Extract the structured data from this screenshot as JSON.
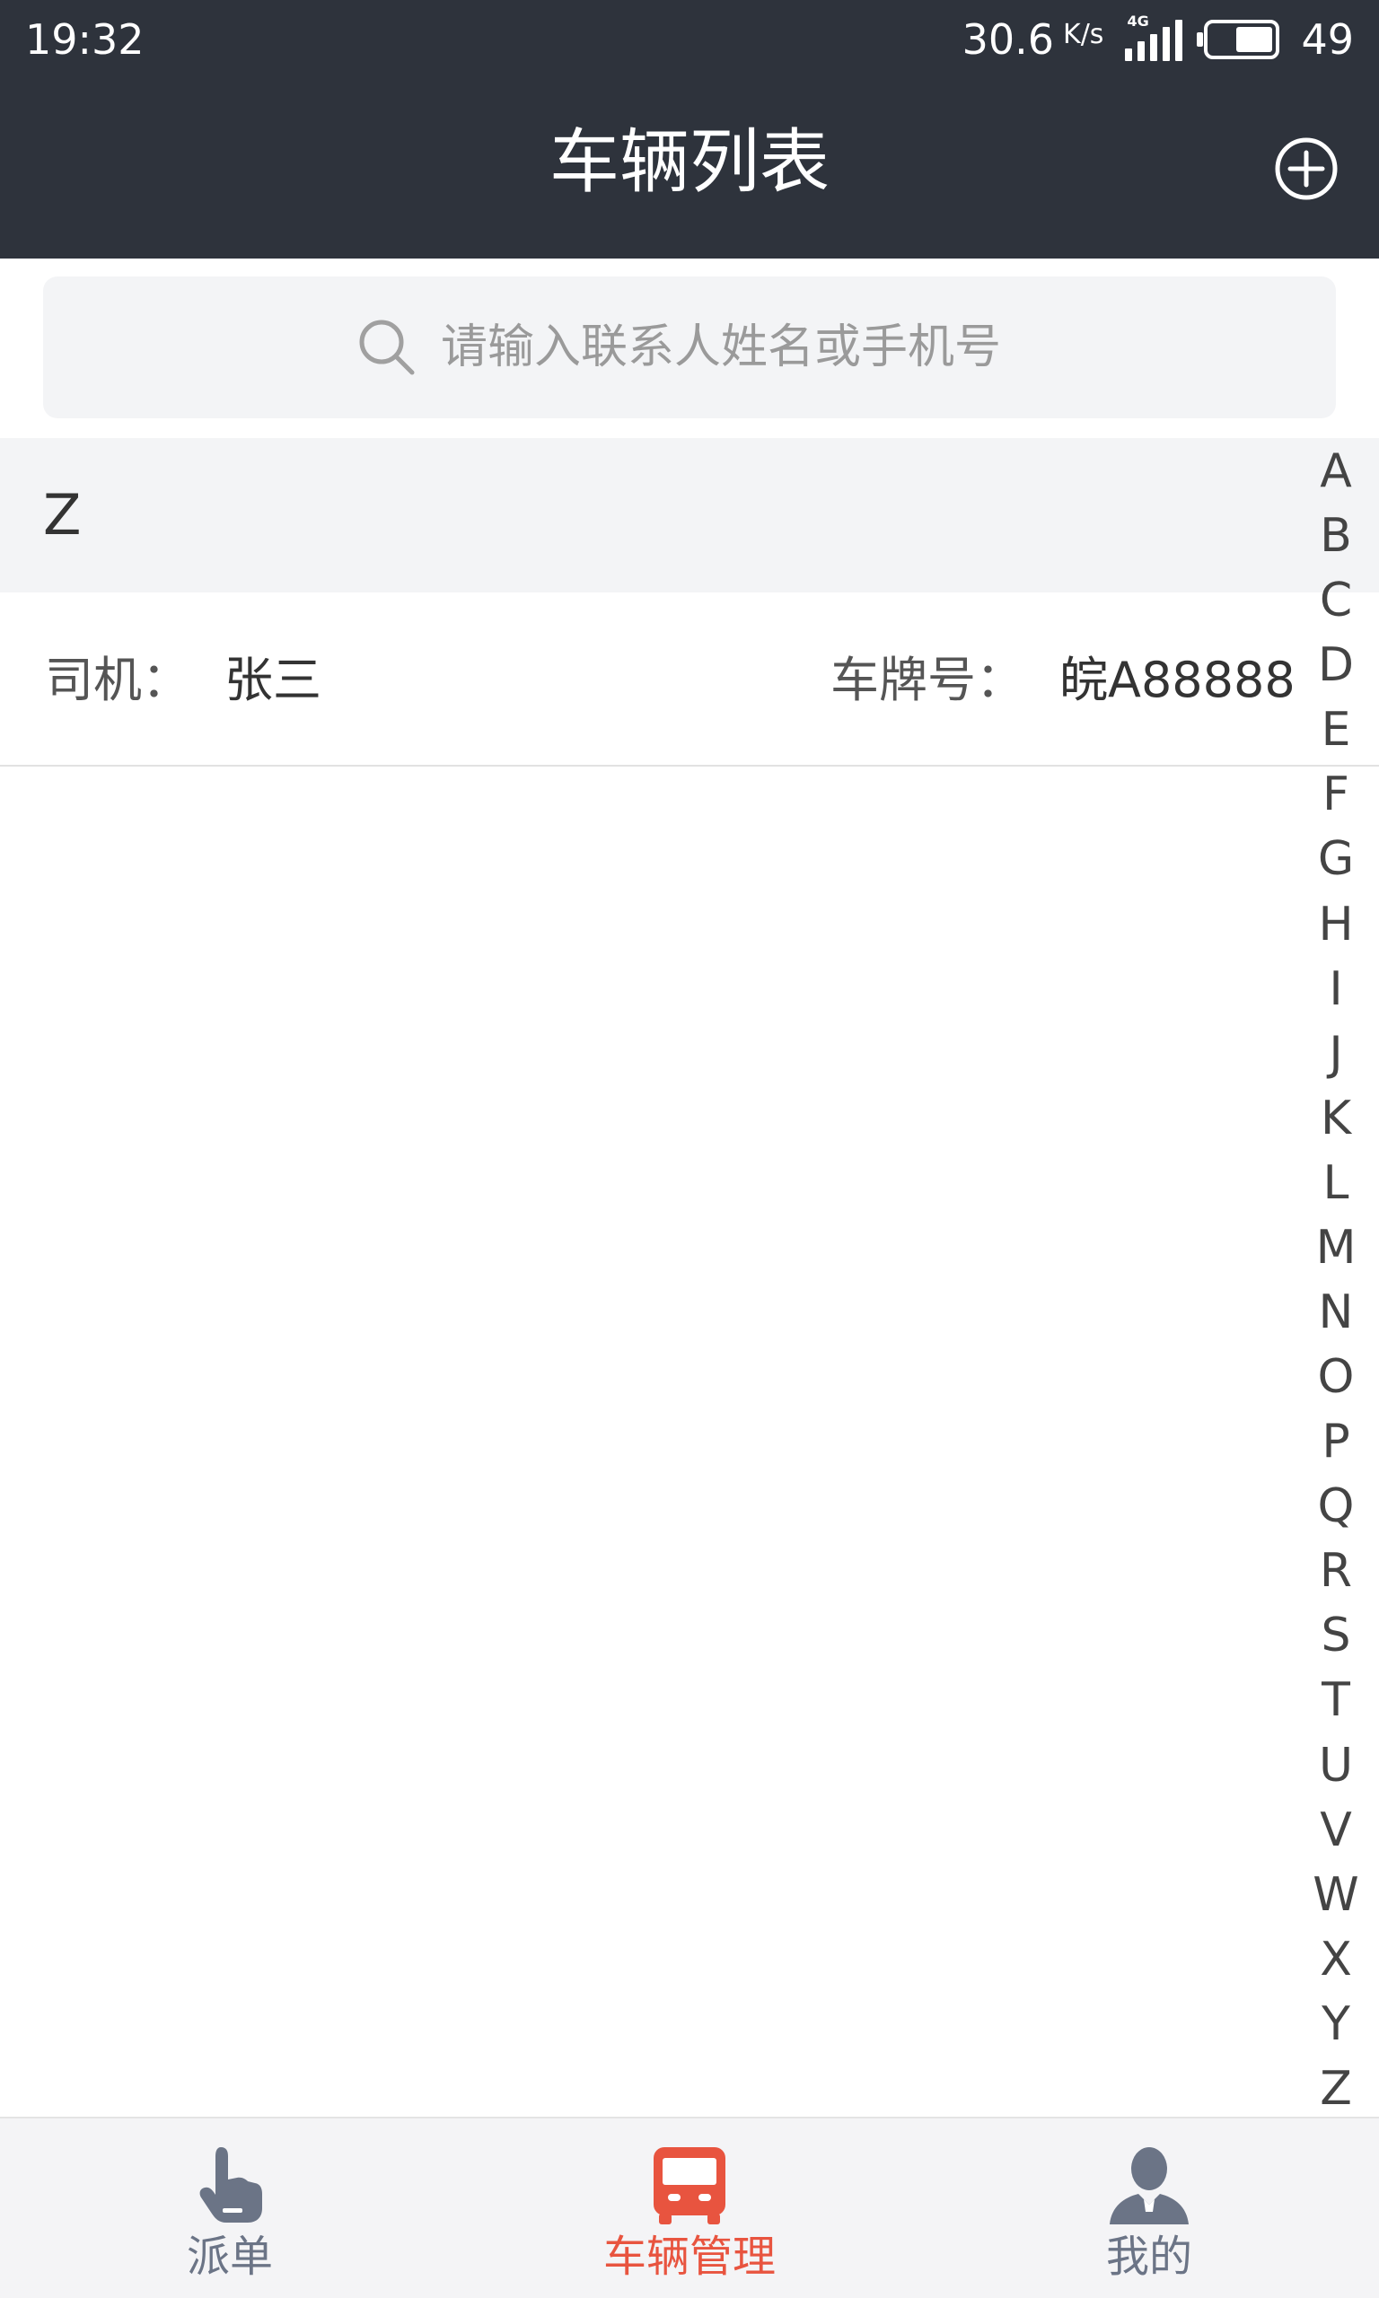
{
  "status_bar": {
    "time": "19:32",
    "net_speed": "30.6",
    "net_unit": "K/s",
    "network_type": "4G",
    "battery": "49"
  },
  "header": {
    "title": "车辆列表",
    "add_icon": "plus-circle-icon"
  },
  "search": {
    "placeholder": "请输入联系人姓名或手机号",
    "icon": "search-icon"
  },
  "list": {
    "sections": [
      {
        "letter": "Z",
        "items": [
          {
            "driver_label": "司机：",
            "driver_name": "张三",
            "plate_label": "车牌号：",
            "plate_number": "皖A88888"
          }
        ]
      }
    ]
  },
  "index_bar": [
    "A",
    "B",
    "C",
    "D",
    "E",
    "F",
    "G",
    "H",
    "I",
    "J",
    "K",
    "L",
    "M",
    "N",
    "O",
    "P",
    "Q",
    "R",
    "S",
    "T",
    "U",
    "V",
    "W",
    "X",
    "Y",
    "Z"
  ],
  "tabs": [
    {
      "label": "派单",
      "icon": "pointing-hand-icon",
      "active": false
    },
    {
      "label": "车辆管理",
      "icon": "bus-icon",
      "active": true
    },
    {
      "label": "我的",
      "icon": "person-icon",
      "active": false
    }
  ],
  "colors": {
    "header_bg": "#2e333c",
    "active_tab": "#e8543f",
    "inactive_tab": "#6b7486",
    "section_bg": "#f3f4f6"
  }
}
